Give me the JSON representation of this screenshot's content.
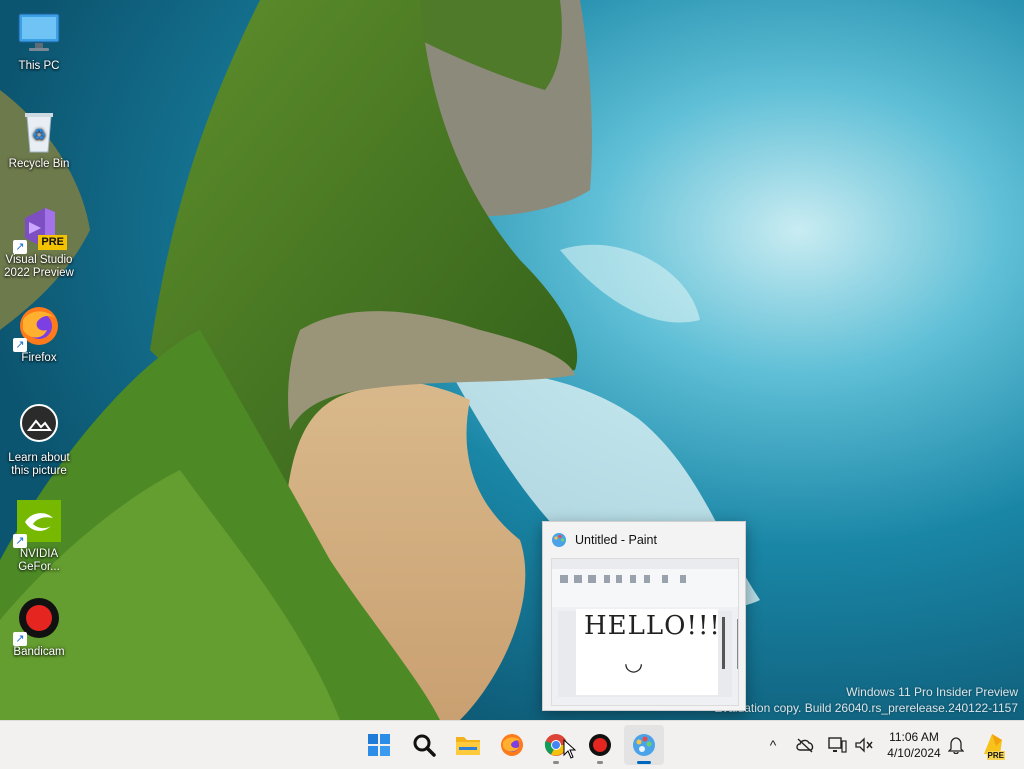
{
  "desktop_icons": [
    {
      "label": "This PC",
      "icon": "monitor-icon"
    },
    {
      "label": "Recycle Bin",
      "icon": "recycle-bin-icon"
    },
    {
      "label": "Visual Studio 2022 Preview",
      "icon": "visual-studio-icon",
      "badge": "PRE"
    },
    {
      "label": "Firefox",
      "icon": "firefox-icon"
    },
    {
      "label": "Learn about this picture",
      "icon": "camera-spotlight-icon"
    },
    {
      "label": "NVIDIA GeFor...",
      "icon": "nvidia-icon"
    },
    {
      "label": "Bandicam",
      "icon": "record-icon"
    }
  ],
  "watermark": {
    "line1": "Windows 11 Pro Insider Preview",
    "line2": "Evaluation copy. Build 26040.rs_prerelease.240122-1157"
  },
  "paint_preview": {
    "title": "Untitled - Paint",
    "canvas_text": "HELLO!!!",
    "canvas_smile": "◡"
  },
  "taskbar": {
    "apps": [
      "start-icon",
      "search-icon",
      "file-explorer-icon",
      "firefox-icon",
      "chrome-icon",
      "bandicam-icon",
      "paint-icon"
    ],
    "active_app": "paint-icon",
    "tray_chevron": "^",
    "clock_time": "11:06 AM",
    "clock_date": "4/10/2024",
    "tray_badge": "PRE"
  },
  "colors": {
    "taskbar_bg": "#f2f1f0",
    "start_blue": "#1e7bd8",
    "accent_red": "#e52620"
  }
}
